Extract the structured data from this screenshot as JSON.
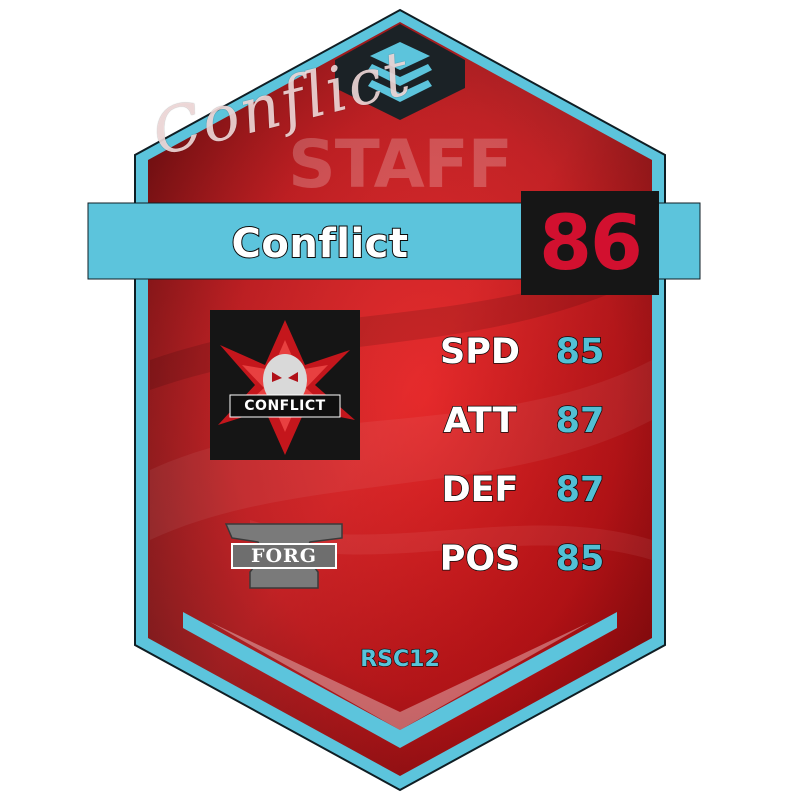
{
  "card": {
    "name": "Conflict",
    "overall": "86",
    "category": "STAFF",
    "signature": "Conflict",
    "footer": "RSC12",
    "team_logo_text": "CONFLICT",
    "forge_logo_text": "FORG",
    "stats": [
      {
        "label": "SPD",
        "value": "85"
      },
      {
        "label": "ATT",
        "value": "87"
      },
      {
        "label": "DEF",
        "value": "87"
      },
      {
        "label": "POS",
        "value": "85"
      }
    ]
  },
  "colors": {
    "frame": "#5cc4dc",
    "background_red": "#c51418",
    "rating_red": "#d2102f",
    "stat_value": "#52bfd4",
    "rating_box": "#161616"
  }
}
